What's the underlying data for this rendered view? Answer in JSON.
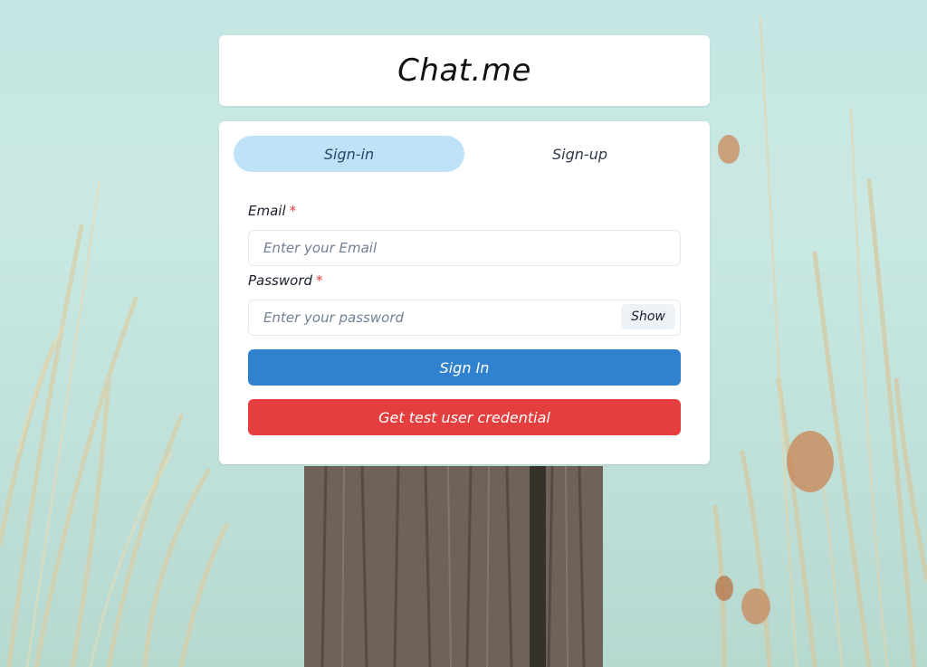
{
  "app": {
    "title": "Chat.me"
  },
  "tabs": [
    {
      "label": "Sign-in",
      "active": true
    },
    {
      "label": "Sign-up",
      "active": false
    }
  ],
  "form": {
    "email": {
      "label": "Email",
      "required_mark": "*",
      "placeholder": "Enter your Email",
      "value": ""
    },
    "password": {
      "label": "Password",
      "required_mark": "*",
      "placeholder": "Enter your password",
      "value": "",
      "show_label": "Show"
    },
    "sign_in_label": "Sign In",
    "guest_label": "Get test user credential"
  },
  "colors": {
    "active_tab": "#bee3f8",
    "primary_button": "#3182ce",
    "danger_button": "#e53e3e",
    "required_mark": "#e53e3e"
  }
}
